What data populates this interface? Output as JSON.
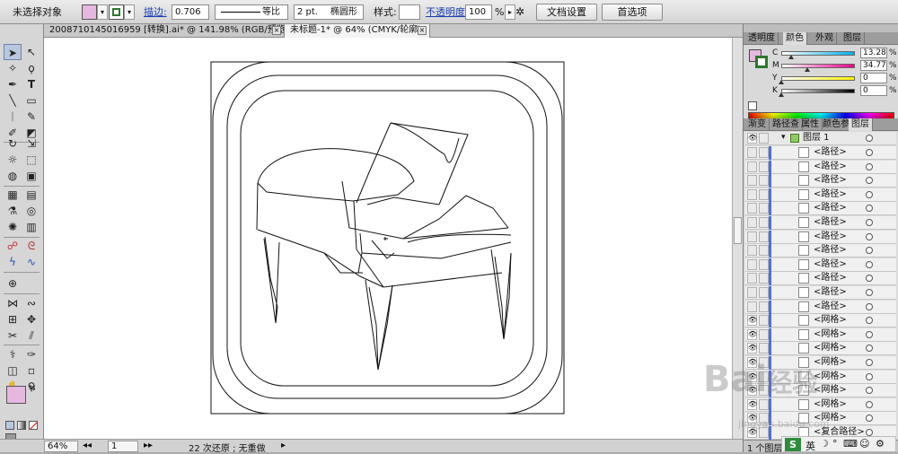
{
  "control_bar": {
    "selection_status": "未选择对象",
    "fill_color": "#e6b8e0",
    "stroke_color": "#2a7a2a",
    "stroke_label": "描边:",
    "stroke_weight": "0.706",
    "stroke_unit_label": "等比",
    "brush_size": "2 pt.",
    "brush_shape": "椭圆形",
    "style_label": "样式:",
    "opacity_label": "不透明度:",
    "opacity_value": "100",
    "opacity_unit": "%",
    "doc_setup_button": "文档设置",
    "preferences_button": "首选项"
  },
  "document_tabs": [
    {
      "label": "2008710145016959 [转换].ai* @ 141.98% (RGB/预览)"
    },
    {
      "label": "未标题-1* @ 64% (CMYK/轮廓)"
    }
  ],
  "toolbox": {
    "fill_swatch": "#e6b8e0",
    "stroke_swatch": "#2a7a2a"
  },
  "color_panel": {
    "tabs": [
      "透明度",
      "颜色",
      "外观",
      "图层"
    ],
    "active_tab": "颜色",
    "fill_swatch": "#e6b8e0",
    "stroke_swatch": "#2a7a2a",
    "channels": [
      {
        "letter": "C",
        "value": "13.28",
        "unit": "%",
        "fraction": 0.1328,
        "gradient": "linear-gradient(90deg,#ffffff,#00aeef)"
      },
      {
        "letter": "M",
        "value": "34.77",
        "unit": "%",
        "fraction": 0.3477,
        "gradient": "linear-gradient(90deg,#ffffff,#ec008c)"
      },
      {
        "letter": "Y",
        "value": "0",
        "unit": "%",
        "fraction": 0,
        "gradient": "linear-gradient(90deg,#ffffff,#fff200)"
      },
      {
        "letter": "K",
        "value": "0",
        "unit": "%",
        "fraction": 0,
        "gradient": "linear-gradient(90deg,#ffffff,#000000)"
      }
    ]
  },
  "layers_panel": {
    "tabs": [
      "渐变",
      "路径查",
      "属性",
      "颜色参",
      "图层"
    ],
    "active_tab": "图层",
    "layer_name": "图层 1",
    "items": [
      {
        "name": "<路径>",
        "eye": false
      },
      {
        "name": "<路径>",
        "eye": false
      },
      {
        "name": "<路径>",
        "eye": false
      },
      {
        "name": "<路径>",
        "eye": false
      },
      {
        "name": "<路径>",
        "eye": false
      },
      {
        "name": "<路径>",
        "eye": false
      },
      {
        "name": "<路径>",
        "eye": false
      },
      {
        "name": "<路径>",
        "eye": false
      },
      {
        "name": "<路径>",
        "eye": false
      },
      {
        "name": "<路径>",
        "eye": false
      },
      {
        "name": "<路径>",
        "eye": false
      },
      {
        "name": "<路径>",
        "eye": false
      },
      {
        "name": "<网格>",
        "eye": true
      },
      {
        "name": "<网格>",
        "eye": true
      },
      {
        "name": "<网格>",
        "eye": true
      },
      {
        "name": "<网格>",
        "eye": true
      },
      {
        "name": "<网格>",
        "eye": true
      },
      {
        "name": "<网格>",
        "eye": true
      },
      {
        "name": "<网格>",
        "eye": true
      },
      {
        "name": "<网格>",
        "eye": true
      },
      {
        "name": "<复合路径>",
        "eye": true
      }
    ],
    "footer_text": "1 个图层"
  },
  "status_bar": {
    "zoom": "64%",
    "page": "1",
    "history": "22 次还原 ; 无重做"
  },
  "watermark": {
    "brand": "Bai",
    "brand2": "经验",
    "url": "jingyan.baidu.com"
  },
  "ime": {
    "label": "S",
    "lang": "英"
  }
}
